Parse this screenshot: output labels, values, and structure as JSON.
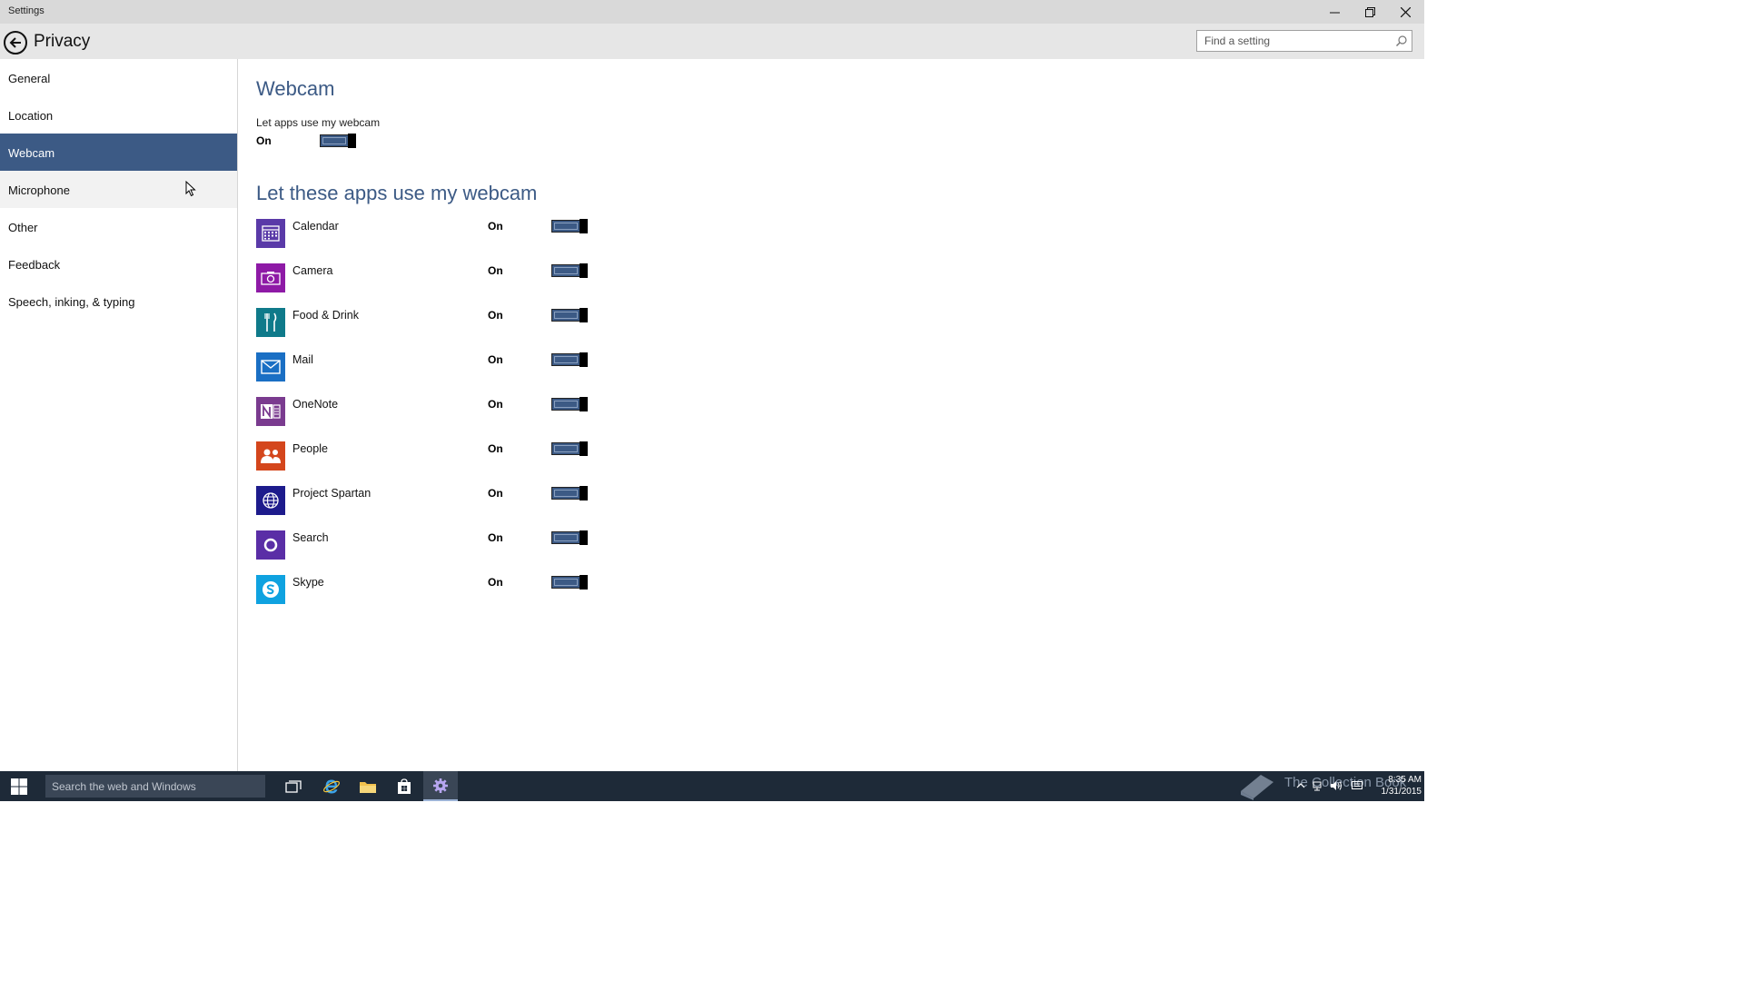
{
  "window": {
    "title": "Settings",
    "controls": [
      "minimize",
      "restore",
      "close"
    ]
  },
  "header": {
    "page_title": "Privacy",
    "search_placeholder": "Find a setting"
  },
  "sidebar": {
    "items": [
      {
        "label": "General"
      },
      {
        "label": "Location"
      },
      {
        "label": "Webcam",
        "selected": true
      },
      {
        "label": "Microphone"
      },
      {
        "label": "Other"
      },
      {
        "label": "Feedback"
      },
      {
        "label": "Speech, inking, & typing"
      }
    ]
  },
  "main": {
    "heading": "Webcam",
    "master_label": "Let apps use my webcam",
    "master_state": "On",
    "apps_heading": "Let these apps use my webcam",
    "apps": [
      {
        "name": "Calendar",
        "state": "On",
        "color": "#5a3aa8",
        "icon": "calendar-icon"
      },
      {
        "name": "Camera",
        "state": "On",
        "color": "#8e1aa6",
        "icon": "camera-icon"
      },
      {
        "name": "Food & Drink",
        "state": "On",
        "color": "#0f7a8a",
        "icon": "food-drink-icon"
      },
      {
        "name": "Mail",
        "state": "On",
        "color": "#1a6fc4",
        "icon": "mail-icon"
      },
      {
        "name": "OneNote",
        "state": "On",
        "color": "#7a3b8f",
        "icon": "onenote-icon"
      },
      {
        "name": "People",
        "state": "On",
        "color": "#d4461c",
        "icon": "people-icon"
      },
      {
        "name": "Project Spartan",
        "state": "On",
        "color": "#1d1b8c",
        "icon": "globe-icon"
      },
      {
        "name": "Search",
        "state": "On",
        "color": "#5a2ea6",
        "icon": "search-ring-icon"
      },
      {
        "name": "Skype",
        "state": "On",
        "color": "#0fa2e0",
        "icon": "skype-icon"
      }
    ]
  },
  "taskbar": {
    "search_placeholder": "Search the web and Windows",
    "watermark": "The Collection Book",
    "time": "8:35 AM",
    "date": "1/31/2015"
  },
  "colors": {
    "accent": "#3c5a85",
    "taskbar": "#1e2a38"
  }
}
